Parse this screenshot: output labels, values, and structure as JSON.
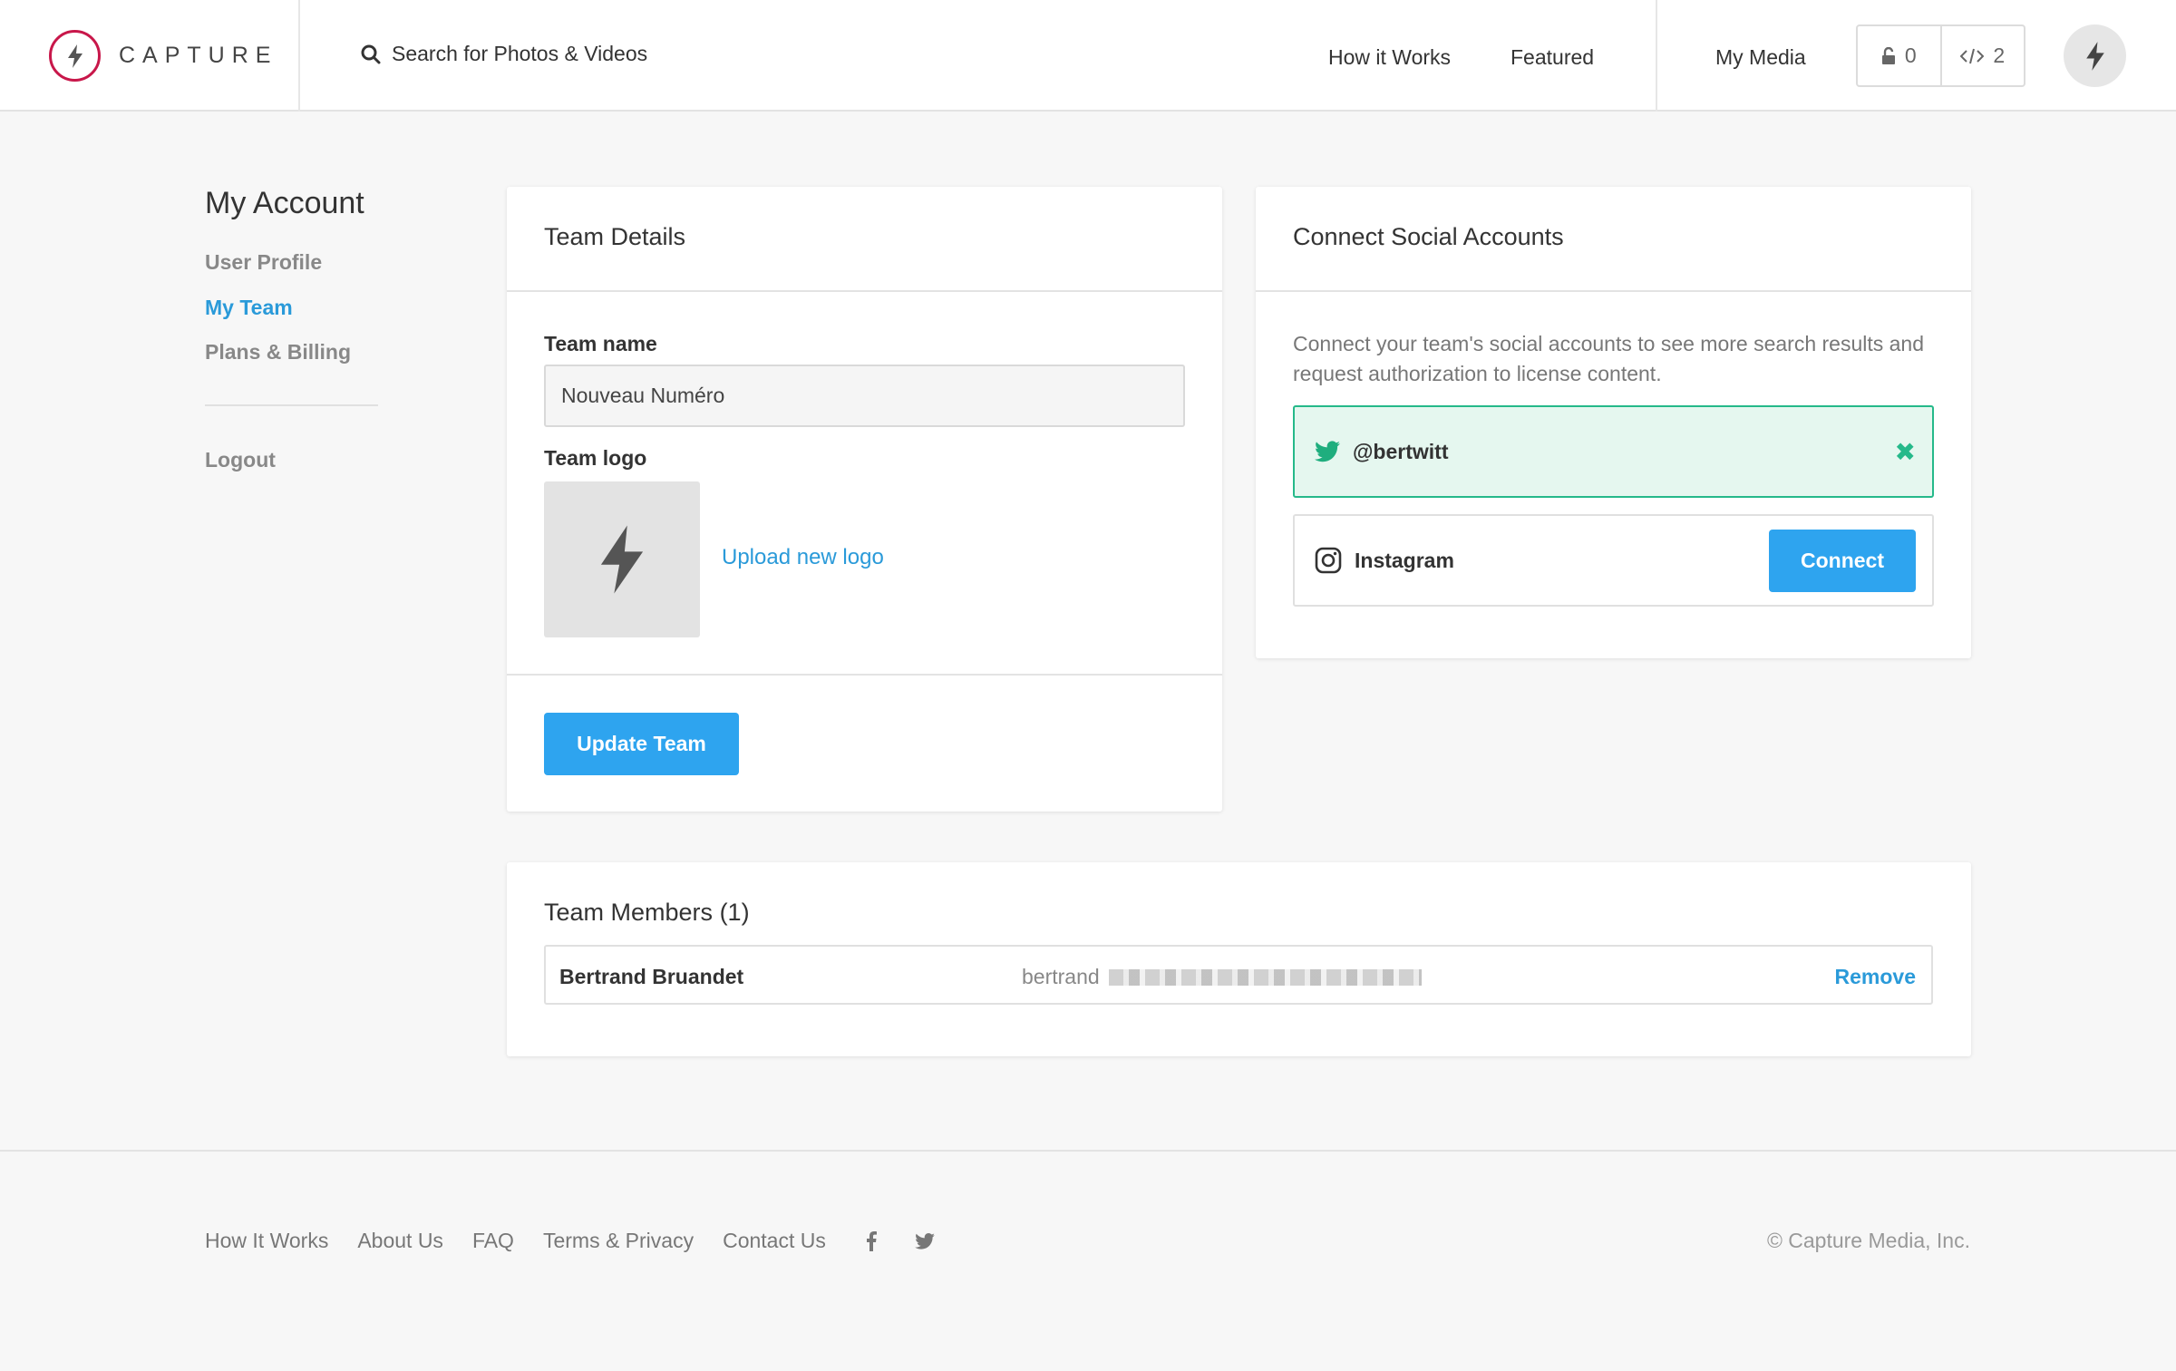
{
  "header": {
    "logo_text": "CAPTURE",
    "search_label": "Search for Photos & Videos",
    "nav": {
      "how_it_works": "How it Works",
      "featured": "Featured",
      "my_media": "My Media"
    },
    "counters": {
      "locked_count": "0",
      "embed_count": "2"
    }
  },
  "sidebar": {
    "title": "My Account",
    "items": [
      {
        "label": "User Profile",
        "active": false
      },
      {
        "label": "My Team",
        "active": true
      },
      {
        "label": "Plans & Billing",
        "active": false
      }
    ],
    "logout": "Logout"
  },
  "team_details": {
    "title": "Team Details",
    "team_name_label": "Team name",
    "team_name_value": "Nouveau Numéro",
    "team_logo_label": "Team logo",
    "upload_link": "Upload new logo",
    "update_button": "Update Team"
  },
  "social": {
    "title": "Connect Social Accounts",
    "description": "Connect your team's social accounts to see more search results and request authorization to license content.",
    "twitter_handle": "@bertwitt",
    "instagram_label": "Instagram",
    "connect_button": "Connect"
  },
  "team_members": {
    "title": "Team Members",
    "count": "(1)",
    "members": [
      {
        "name": "Bertrand Bruandet",
        "email_visible": "bertrand",
        "action": "Remove"
      }
    ]
  },
  "footer": {
    "links": [
      "How It Works",
      "About Us",
      "FAQ",
      "Terms & Privacy",
      "Contact Us"
    ],
    "copyright": "© Capture Media, Inc."
  },
  "colors": {
    "accent": "#2a9ad9",
    "button": "#2ea4ef",
    "brand": "#c8174a",
    "connected_green": "#25b98a",
    "connected_bg": "#e5f7ef"
  },
  "icons": [
    "lightning-icon",
    "search-icon",
    "lock-icon",
    "code-icon",
    "twitter-icon",
    "instagram-icon",
    "close-icon",
    "facebook-icon"
  ]
}
